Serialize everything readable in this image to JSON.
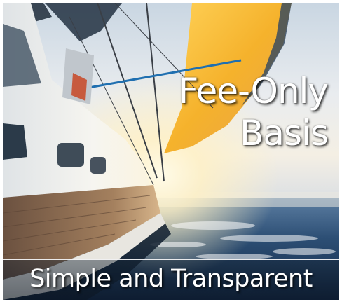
{
  "headline": {
    "line1": "Fee-Only",
    "line2": "Basis"
  },
  "banner": {
    "text": "Simple and Transparent"
  },
  "image": {
    "subject": "sailboat-at-sunset-photo",
    "colors": {
      "sky": "#dfe9f2",
      "sun": "#fff3c4",
      "sail": "#f2b230",
      "sea": "#1e3a5c",
      "hull": "#f3f3f0"
    }
  }
}
